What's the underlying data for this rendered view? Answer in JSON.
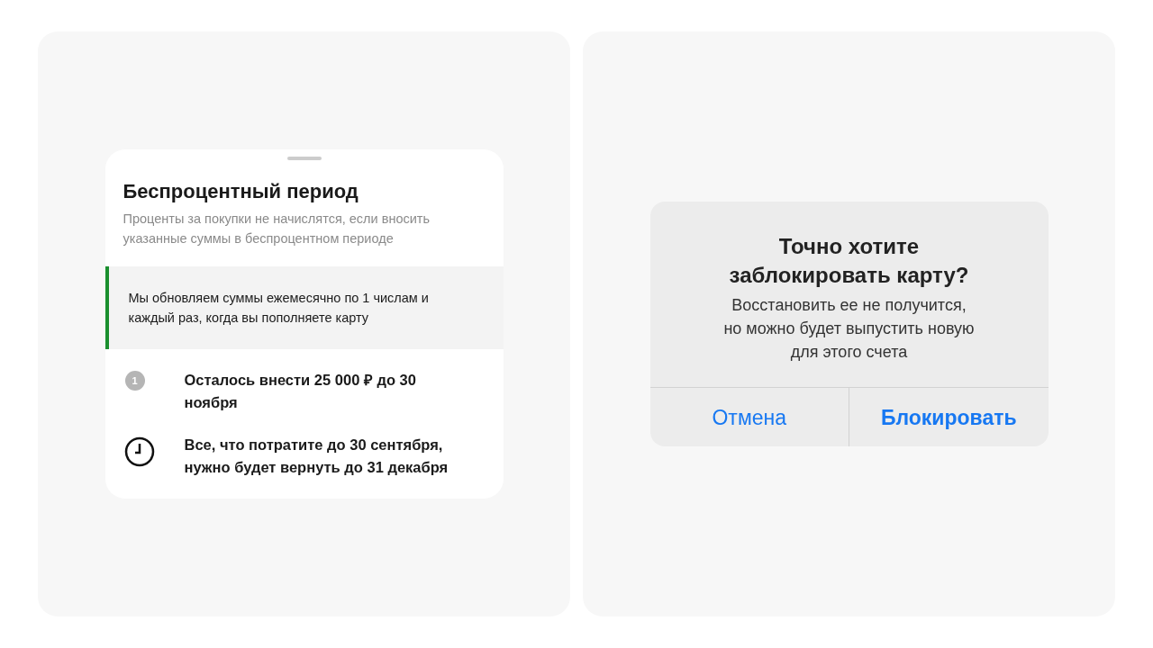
{
  "free_period_sheet": {
    "title": "Беспроцентный период",
    "subtitle": "Проценты за покупки не начислятся, если вносить указанные суммы в беспроцентном периоде",
    "notice": "Мы обновляем суммы ежемесячно по 1 числам и каждый раз, когда вы пополняете карту",
    "items": [
      {
        "kind": "number",
        "badge": "1",
        "text": "Осталось внести 25 000 ₽ до 30 ноября"
      },
      {
        "kind": "clock",
        "text": "Все, что потратите до 30 сентября, нужно будет вернуть до 31 декабря"
      }
    ]
  },
  "block_dialog": {
    "title": "Точно хотите заблокировать карту?",
    "message": "Восстановить ее не получится, но можно будет выпустить новую для этого счета",
    "buttons": [
      {
        "label": "Отмена",
        "bold": false
      },
      {
        "label": "Блокировать",
        "bold": true
      }
    ]
  }
}
